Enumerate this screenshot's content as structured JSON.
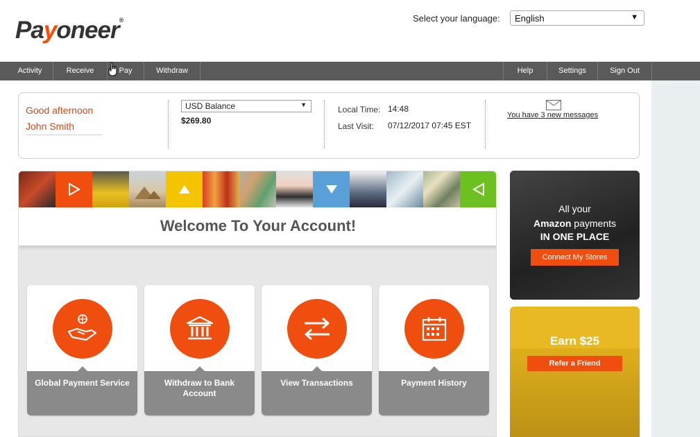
{
  "header": {
    "logo_main": "Pa",
    "logo_accent": "y",
    "logo_rest": "oneer",
    "logo_reg": "®",
    "language_label": "Select your language:",
    "language_value": "English"
  },
  "nav": {
    "left": [
      {
        "label": "Activity"
      },
      {
        "label": "Receive"
      },
      {
        "label": "Pay"
      },
      {
        "label": "Withdraw"
      }
    ],
    "right": [
      {
        "label": "Help"
      },
      {
        "label": "Settings"
      },
      {
        "label": "Sign Out"
      }
    ]
  },
  "info": {
    "greeting": "Good afternoon",
    "user_name": "John Smith",
    "balance_select": "USD Balance",
    "balance_amount": "$269.80",
    "local_time_label": "Local Time:",
    "local_time_value": "14:48",
    "last_visit_label": "Last Visit:",
    "last_visit_value": "07/12/2017 07:45 EST",
    "messages_link": "You have 3 new messages"
  },
  "main": {
    "welcome_title": "Welcome To Your Account!",
    "cards": [
      {
        "label": "Global Payment Service",
        "icon": "global-payment-icon"
      },
      {
        "label": "Withdraw to Bank Account",
        "icon": "bank-icon"
      },
      {
        "label": "View Transactions",
        "icon": "transactions-icon"
      },
      {
        "label": "Payment History",
        "icon": "calendar-icon"
      }
    ]
  },
  "ads": {
    "amazon": {
      "line1": "All your",
      "line2_bold": "Amazon",
      "line2_rest": " payments",
      "line3": "IN ONE PLACE",
      "button": "Connect My Stores"
    },
    "referral": {
      "title": "Earn $25",
      "button": "Refer a Friend"
    }
  },
  "colors": {
    "brand_orange": "#f04e0f",
    "nav_bg": "#5a5a5a",
    "greeting_text": "#c94a1a"
  }
}
